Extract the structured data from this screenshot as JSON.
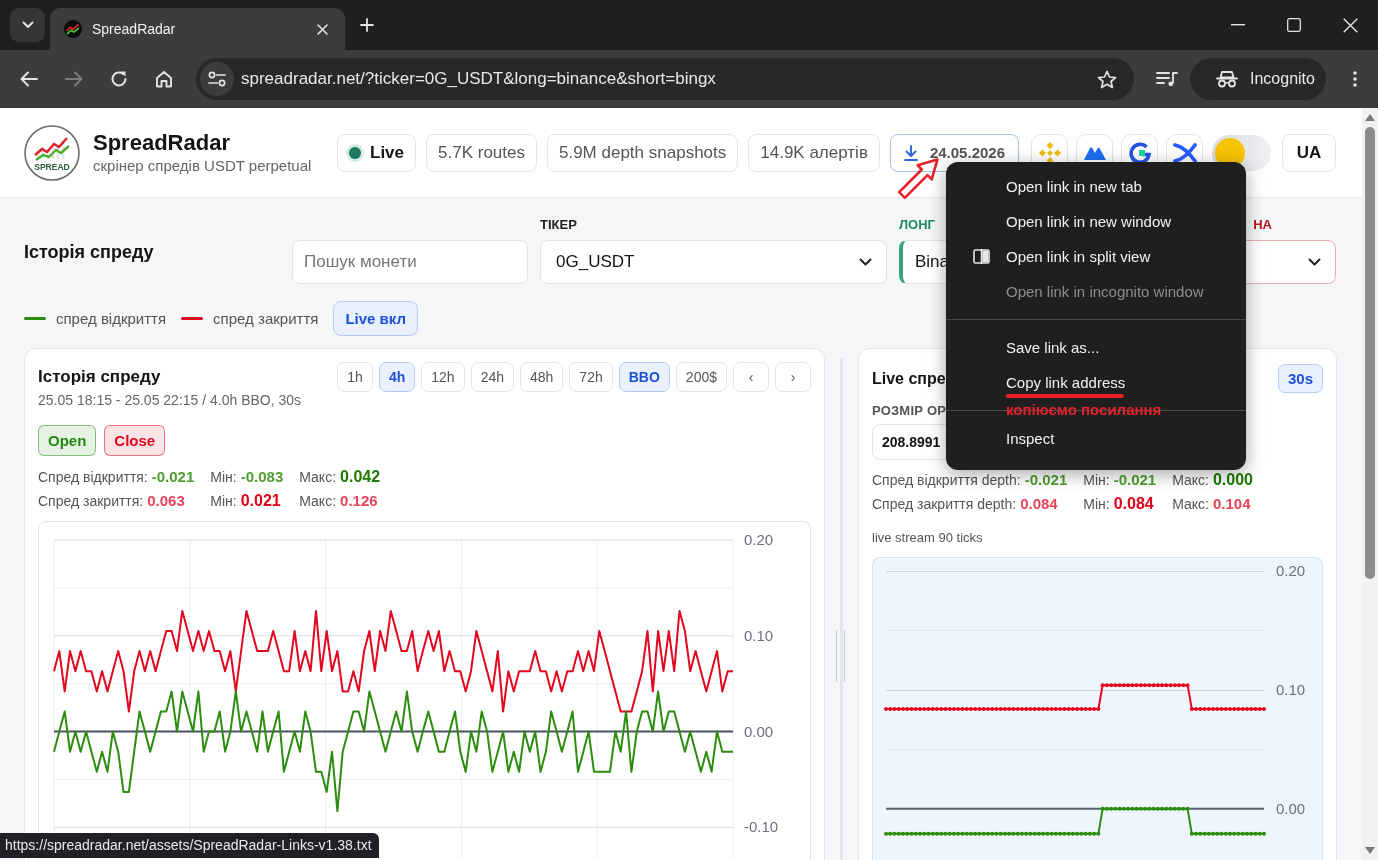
{
  "browser": {
    "tab_title": "SpreadRadar",
    "nav": {
      "back_disabled": false,
      "forward_disabled": true
    },
    "url": "spreadradar.net/?ticker=0G_USDT&long=binance&short=bingx",
    "profile": "Incognito"
  },
  "header": {
    "logo_text": "SPREAD",
    "title": "SpreadRadar",
    "subtitle": "скрінер спредів USDT perpetual",
    "status": {
      "label": "Live",
      "color": "#1e7a5e"
    },
    "stats": [
      "5.7K routes",
      "5.9M depth snapshots",
      "14.9K алертів"
    ],
    "download": "24.05.2026",
    "theme_toggle": {
      "on": false
    },
    "language": "UA"
  },
  "controls": {
    "title": "Історія спреду",
    "search": {
      "placeholder": "Пошук монети"
    },
    "selects": [
      {
        "kind": "plain",
        "label": "ТІКЕР",
        "value": "0G_USDT"
      },
      {
        "kind": "long",
        "label": "ЛОНГ",
        "value": "Bina"
      },
      {
        "kind": "short",
        "label": "НА"
      }
    ],
    "legend": [
      {
        "label": "спред відкриття",
        "color": "#2c8c0e"
      },
      {
        "label": "спред закриття",
        "color": "#e3061f"
      }
    ],
    "live_button": {
      "label": "Live вкл",
      "on": true
    }
  },
  "history": {
    "title": "Історія спреду",
    "subtitle": "25.05 18:15 - 25.05 22:15 / 4.0h BBO, 30s",
    "ranges": [
      {
        "label": "1h",
        "selected": false
      },
      {
        "label": "4h",
        "selected": true
      },
      {
        "label": "12h",
        "selected": false
      },
      {
        "label": "24h",
        "selected": false
      },
      {
        "label": "48h",
        "selected": false
      },
      {
        "label": "72h",
        "selected": false
      },
      {
        "label": "BBO",
        "selected": true
      },
      {
        "label": "200$",
        "selected": false
      },
      {
        "label": "‹",
        "selected": false
      },
      {
        "label": "›",
        "selected": false
      }
    ],
    "toggles": [
      {
        "label": "Open",
        "on": true,
        "color": "#23880f"
      },
      {
        "label": "Close",
        "on": true,
        "color": "#e0061d"
      }
    ],
    "stats": [
      [
        {
          "label": "Спред відкриття:",
          "value": "-0.021",
          "color": "#4e9e2f",
          "strong": false
        },
        {
          "label": "Мін:",
          "value": "-0.083",
          "color": "#4e9e2f",
          "strong": false
        },
        {
          "label": "Макс:",
          "value": "0.042",
          "color": "#1d7a00",
          "strong": true
        }
      ],
      [
        {
          "label": "Спред закриття:",
          "value": "0.063",
          "color": "#e9435b",
          "strong": false
        },
        {
          "label": "Мін:",
          "value": "0.021",
          "color": "#e00019",
          "strong": true
        },
        {
          "label": "Макс:",
          "value": "0.126",
          "color": "#e9435b",
          "strong": false
        }
      ]
    ],
    "chart_data": {
      "type": "line",
      "ylim": [
        -0.133,
        0.2
      ],
      "yticks": [
        {
          "value": 0.2,
          "label": "0.20"
        },
        {
          "value": 0.1,
          "label": "0.10"
        },
        {
          "value": 0,
          "label": "0.00"
        },
        {
          "value": -0.1,
          "label": "-0.10"
        }
      ],
      "series": [
        {
          "color": "#e3061f",
          "values": [
            0.063,
            0.084,
            0.042,
            0.084,
            0.063,
            0.084,
            0.063,
            0.063,
            0.042,
            0.063,
            0.042,
            0.063,
            0.084,
            0.063,
            0.021,
            0.063,
            0.084,
            0.063,
            0.084,
            0.063,
            0.084,
            0.105,
            0.105,
            0.084,
            0.126,
            0.105,
            0.084,
            0.105,
            0.084,
            0.105,
            0.084,
            0.084,
            0.063,
            0.084,
            0.042,
            0.084,
            0.126,
            0.105,
            0.084,
            0.084,
            0.084,
            0.105,
            0.084,
            0.063,
            0.063,
            0.105,
            0.063,
            0.084,
            0.063,
            0.126,
            0.063,
            0.105,
            0.063,
            0.084,
            0.042,
            0.042,
            0.063,
            0.042,
            0.084,
            0.105,
            0.063,
            0.105,
            0.084,
            0.126,
            0.105,
            0.084,
            0.084,
            0.105,
            0.063,
            0.084,
            0.105,
            0.084,
            0.105,
            0.063,
            0.084,
            0.063,
            0.063,
            0.042,
            0.063,
            0.105,
            0.084,
            0.063,
            0.042,
            0.084,
            0.021,
            0.063,
            0.042,
            0.063,
            0.063,
            0.063,
            0.084,
            0.063,
            0.063,
            0.042,
            0.063,
            0.042,
            0.063,
            0.063,
            0.084,
            0.063,
            0.084,
            0.063,
            0.105,
            0.084,
            0.063,
            0.042,
            0.021,
            0.021,
            0.021,
            0.042,
            0.063,
            0.105,
            0.042,
            0.105,
            0.063,
            0.105,
            0.063,
            0.126,
            0.105,
            0.063,
            0.084,
            0.063,
            0.042,
            0.063,
            0.084,
            0.042,
            0.063,
            0.063
          ]
        },
        {
          "color": "#2c8c0e",
          "values": [
            -0.021,
            0.0,
            0.021,
            -0.021,
            0.0,
            -0.021,
            0.0,
            -0.021,
            -0.042,
            -0.021,
            -0.042,
            0.0,
            -0.021,
            -0.063,
            -0.063,
            -0.021,
            0.021,
            0.0,
            -0.021,
            0.0,
            0.021,
            0.021,
            0.042,
            0.0,
            0.042,
            0.021,
            0.0,
            0.042,
            -0.021,
            0.0,
            0.0,
            0.021,
            -0.021,
            0.0,
            0.042,
            0.0,
            0.021,
            0.0,
            -0.021,
            0.021,
            -0.021,
            0.0,
            0.021,
            -0.042,
            -0.021,
            0.0,
            -0.021,
            0.021,
            0.0,
            -0.042,
            -0.042,
            -0.063,
            -0.021,
            -0.083,
            -0.021,
            0.0,
            0.021,
            0.021,
            0.0,
            0.042,
            0.021,
            0.0,
            -0.021,
            0.0,
            0.021,
            0.0,
            0.042,
            0.0,
            -0.021,
            0.0,
            0.021,
            0.0,
            -0.021,
            -0.021,
            0.0,
            0.021,
            -0.021,
            -0.042,
            0.0,
            -0.021,
            0.021,
            0.0,
            -0.042,
            -0.021,
            0.0,
            -0.042,
            -0.021,
            -0.042,
            0.0,
            -0.021,
            0.0,
            -0.042,
            -0.021,
            0.021,
            0.0,
            -0.021,
            0.0,
            0.021,
            -0.042,
            -0.021,
            0.0,
            -0.042,
            -0.042,
            -0.042,
            -0.042,
            0.0,
            -0.021,
            0.021,
            -0.042,
            0.0,
            0.021,
            0.021,
            0.0,
            0.042,
            0.0,
            0.021,
            0.021,
            0.0,
            -0.021,
            0.0,
            -0.021,
            -0.042,
            -0.021,
            -0.042,
            0.0,
            -0.021,
            -0.021,
            -0.021
          ]
        }
      ]
    }
  },
  "live": {
    "title": "Live спре",
    "interval": "30s",
    "size_label": "РОЗМІР ОР",
    "size_value": "208.8991",
    "stats": [
      [
        {
          "label": "Спред відкриття depth:",
          "value": "-0.021",
          "color": "#4e9e2f",
          "strong": false
        },
        {
          "label": "Мін:",
          "value": "-0.021",
          "color": "#4e9e2f",
          "strong": false
        },
        {
          "label": "Макс:",
          "value": "0.000",
          "color": "#1d7a00",
          "strong": true
        }
      ],
      [
        {
          "label": "Спред закриття depth:",
          "value": "0.084",
          "color": "#e9435b",
          "strong": false
        },
        {
          "label": "Мін:",
          "value": "0.084",
          "color": "#e00019",
          "strong": true
        },
        {
          "label": "Макс:",
          "value": "0.104",
          "color": "#e9435b",
          "strong": false
        }
      ]
    ],
    "caption": "live stream 90 ticks",
    "chart_data": {
      "type": "line",
      "ylim": [
        -0.043,
        0.2
      ],
      "yticks": [
        {
          "value": 0.2,
          "label": "0.20"
        },
        {
          "value": 0.1,
          "label": "0.10"
        },
        {
          "value": 0,
          "label": "0.00"
        }
      ],
      "series": [
        {
          "color": "#e3061f",
          "values": [
            0.084,
            0.084,
            0.084,
            0.084,
            0.084,
            0.084,
            0.084,
            0.084,
            0.084,
            0.084,
            0.084,
            0.084,
            0.084,
            0.084,
            0.084,
            0.084,
            0.084,
            0.084,
            0.084,
            0.084,
            0.084,
            0.084,
            0.084,
            0.084,
            0.084,
            0.084,
            0.084,
            0.084,
            0.084,
            0.084,
            0.084,
            0.084,
            0.084,
            0.084,
            0.084,
            0.084,
            0.084,
            0.084,
            0.084,
            0.084,
            0.084,
            0.084,
            0.084,
            0.084,
            0.084,
            0.084,
            0.084,
            0.084,
            0.084,
            0.084,
            0.084,
            0.104,
            0.104,
            0.104,
            0.104,
            0.104,
            0.104,
            0.104,
            0.104,
            0.104,
            0.104,
            0.104,
            0.104,
            0.104,
            0.104,
            0.104,
            0.104,
            0.104,
            0.104,
            0.104,
            0.104,
            0.104,
            0.084,
            0.084,
            0.084,
            0.084,
            0.084,
            0.084,
            0.084,
            0.084,
            0.084,
            0.084,
            0.084,
            0.084,
            0.084,
            0.084,
            0.084,
            0.084,
            0.084,
            0.084
          ]
        },
        {
          "color": "#2c8c0e",
          "values": [
            -0.021,
            -0.021,
            -0.021,
            -0.021,
            -0.021,
            -0.021,
            -0.021,
            -0.021,
            -0.021,
            -0.021,
            -0.021,
            -0.021,
            -0.021,
            -0.021,
            -0.021,
            -0.021,
            -0.021,
            -0.021,
            -0.021,
            -0.021,
            -0.021,
            -0.021,
            -0.021,
            -0.021,
            -0.021,
            -0.021,
            -0.021,
            -0.021,
            -0.021,
            -0.021,
            -0.021,
            -0.021,
            -0.021,
            -0.021,
            -0.021,
            -0.021,
            -0.021,
            -0.021,
            -0.021,
            -0.021,
            -0.021,
            -0.021,
            -0.021,
            -0.021,
            -0.021,
            -0.021,
            -0.021,
            -0.021,
            -0.021,
            -0.021,
            -0.021,
            0.0,
            0.0,
            0.0,
            0.0,
            0.0,
            0.0,
            0.0,
            0.0,
            0.0,
            0.0,
            0.0,
            0.0,
            0.0,
            0.0,
            0.0,
            0.0,
            0.0,
            0.0,
            0.0,
            0.0,
            0.0,
            -0.021,
            -0.021,
            -0.021,
            -0.021,
            -0.021,
            -0.021,
            -0.021,
            -0.021,
            -0.021,
            -0.021,
            -0.021,
            -0.021,
            -0.021,
            -0.021,
            -0.021,
            -0.021,
            -0.021,
            -0.021
          ]
        }
      ]
    }
  },
  "context_menu": {
    "groups": [
      {
        "items": [
          {
            "label": "Open link in new tab",
            "disabled": false,
            "icon": false
          },
          {
            "label": "Open link in new window",
            "disabled": false,
            "icon": false
          },
          {
            "label": "Open link in split view",
            "disabled": false,
            "icon": true
          },
          {
            "label": "Open link in incognito window",
            "disabled": true,
            "icon": false
          }
        ]
      },
      {
        "items": [
          {
            "label": "Save link as...",
            "disabled": false,
            "icon": false
          },
          {
            "label": "Copy link address",
            "disabled": false,
            "icon": false
          }
        ]
      },
      {
        "items": [
          {
            "label": "Inspect",
            "disabled": false,
            "icon": false
          }
        ]
      }
    ]
  },
  "annotation": {
    "note": "копіюємо посилання"
  },
  "status_link": "https://spreadradar.net/assets/SpreadRadar-Links-v1.38.txt"
}
